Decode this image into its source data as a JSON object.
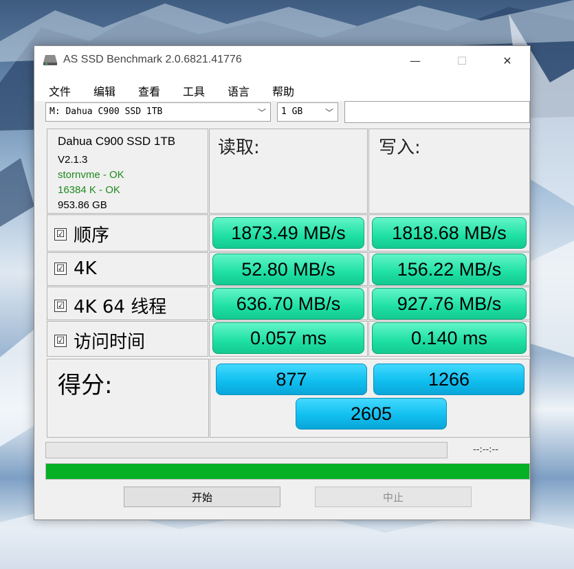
{
  "window": {
    "title": "AS SSD Benchmark 2.0.6821.41776",
    "controls": {
      "minimize": "—",
      "maximize": "☐",
      "close": "✕"
    }
  },
  "menu": [
    "文件",
    "编辑",
    "查看",
    "工具",
    "语言",
    "帮助"
  ],
  "toolbar": {
    "drive": "M: Dahua C900 SSD 1TB",
    "size": "1 GB",
    "text_field": ""
  },
  "info": {
    "name": "Dahua C900 SSD 1TB",
    "firmware": "V2.1.3",
    "driver_status": "stornvme - OK",
    "alignment_status": "16384 K - OK",
    "capacity": "953.86 GB",
    "ok_color": "#1e8a1e"
  },
  "columns": {
    "read": "读取:",
    "write": "写入:"
  },
  "tests": [
    {
      "label": "顺序",
      "read": "1873.49 MB/s",
      "write": "1818.68 MB/s"
    },
    {
      "label": "4K",
      "read": "52.80 MB/s",
      "write": "156.22 MB/s"
    },
    {
      "label": "4K 64 线程",
      "read": "636.70 MB/s",
      "write": "927.76 MB/s"
    },
    {
      "label": "访问时间",
      "read": "0.057 ms",
      "write": "0.140 ms"
    }
  ],
  "check_mark": "☑",
  "score": {
    "label": "得分:",
    "read": "877",
    "write": "1266",
    "total": "2605"
  },
  "progress": {
    "time": "--:--:--",
    "overall_fraction": 1.0,
    "bar_color": "#06b025"
  },
  "buttons": {
    "start": "开始",
    "stop": "中止"
  },
  "colors": {
    "result_green": "#1ee0a3",
    "score_blue": "#10bfef"
  }
}
